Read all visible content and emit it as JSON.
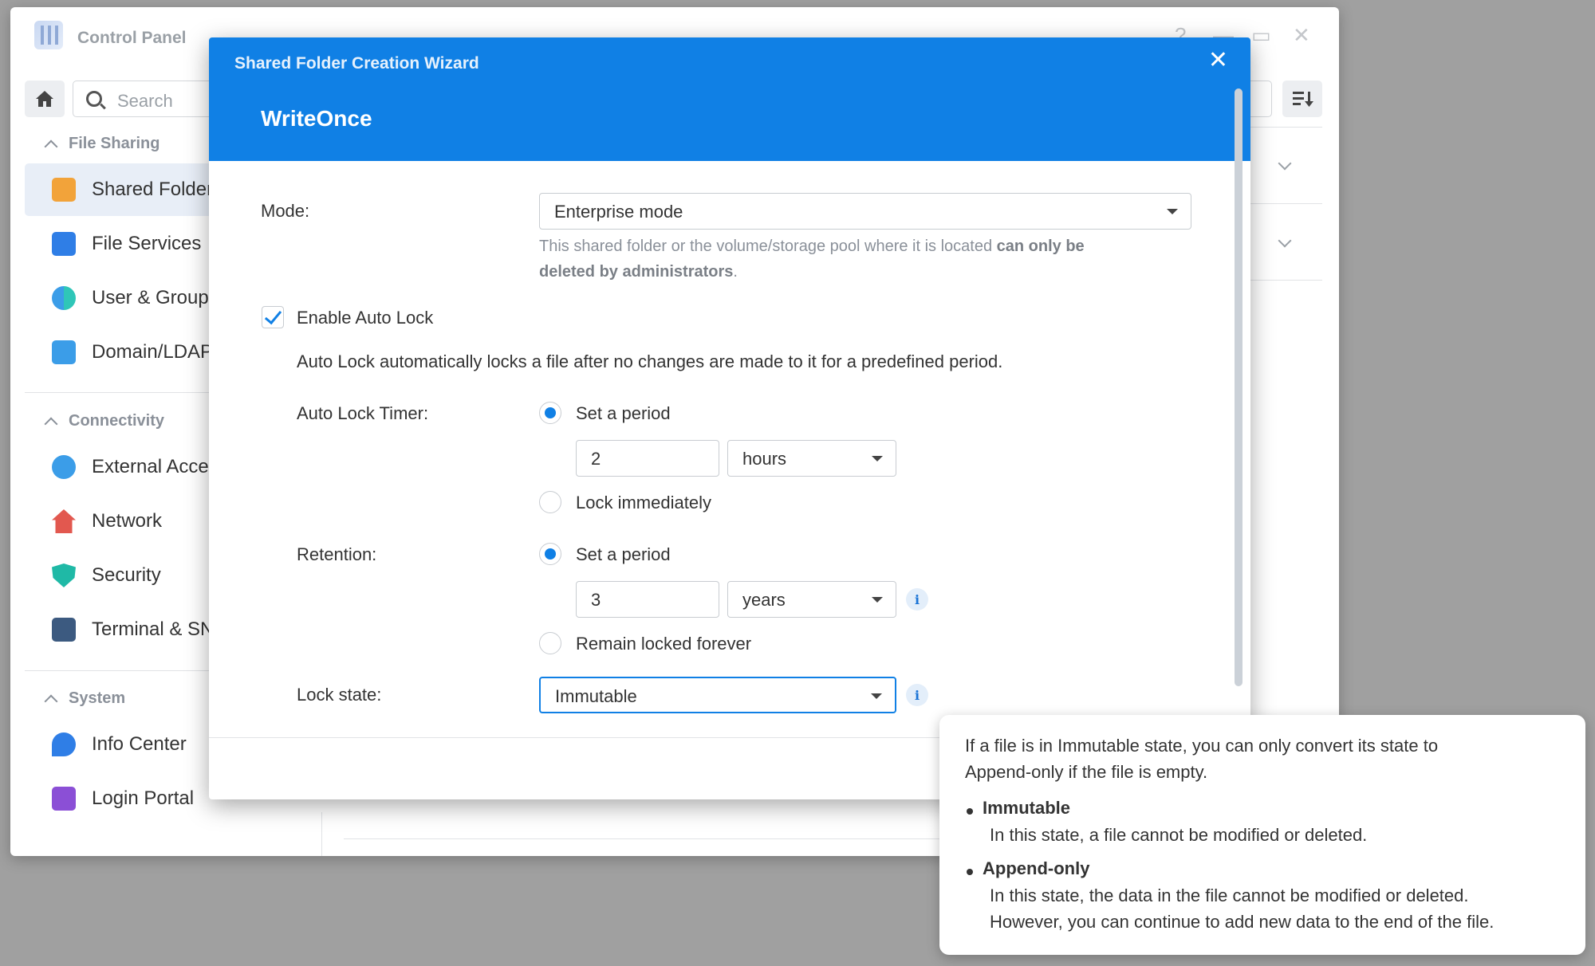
{
  "control_panel": {
    "title": "Control Panel",
    "search_placeholder": "Search",
    "window_controls": {
      "help": "?",
      "minimize": "—",
      "maximize": "▭",
      "close": "✕"
    },
    "sections": [
      {
        "label": "File Sharing",
        "items": [
          {
            "label": "Shared Folder",
            "icon": "shared-folder-icon"
          },
          {
            "label": "File Services",
            "icon": "file-services-icon"
          },
          {
            "label": "User & Group",
            "icon": "user-group-icon"
          },
          {
            "label": "Domain/LDAP",
            "icon": "domain-ldap-icon"
          }
        ]
      },
      {
        "label": "Connectivity",
        "items": [
          {
            "label": "External Access",
            "icon": "external-access-icon"
          },
          {
            "label": "Network",
            "icon": "network-icon"
          },
          {
            "label": "Security",
            "icon": "security-icon"
          },
          {
            "label": "Terminal & SNMP",
            "icon": "terminal-icon"
          }
        ]
      },
      {
        "label": "System",
        "items": [
          {
            "label": "Info Center",
            "icon": "info-center-icon"
          },
          {
            "label": "Login Portal",
            "icon": "login-portal-icon"
          }
        ]
      }
    ]
  },
  "wizard": {
    "title": "Shared Folder Creation Wizard",
    "close": "✕",
    "step_title": "WriteOnce",
    "mode": {
      "label": "Mode:",
      "value": "Enterprise mode",
      "hint_plain_1": "This shared folder or the volume/storage pool where it is located ",
      "hint_bold_1": "can only be",
      "hint_bold_2": "deleted by administrators",
      "hint_plain_2": "."
    },
    "auto_lock": {
      "checkbox_label": "Enable Auto Lock",
      "checked": true,
      "description": "Auto Lock automatically locks a file after no changes are made to it for a predefined period.",
      "timer_label": "Auto Lock Timer:",
      "timer_option_period": "Set a period",
      "timer_value": "2",
      "timer_unit": "hours",
      "timer_option_immediate": "Lock immediately",
      "timer_selected": "period"
    },
    "retention": {
      "label": "Retention:",
      "option_period": "Set a period",
      "value": "3",
      "unit": "years",
      "option_forever": "Remain locked forever",
      "selected": "period"
    },
    "lock_state": {
      "label": "Lock state:",
      "value": "Immutable"
    },
    "info_glyph": "i"
  },
  "tooltip": {
    "intro_line_1": "If a file is in Immutable state, you can only convert its state to",
    "intro_line_2": "Append-only if the file is empty.",
    "items": [
      {
        "title": "Immutable",
        "lines": [
          "In this state, a file cannot be modified or deleted."
        ]
      },
      {
        "title": "Append-only",
        "lines": [
          "In this state, the data in the file cannot be modified or deleted.",
          "However, you can continue to add new data to the end of the file."
        ]
      }
    ]
  },
  "colors": {
    "accent": "#1080e5",
    "backdrop": "#a0a0a0"
  }
}
